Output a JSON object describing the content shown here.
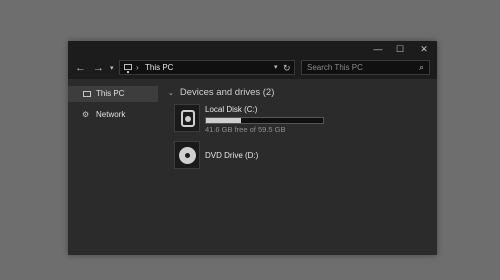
{
  "window": {
    "title": "This PC",
    "controls": {
      "minimize": "—",
      "maximize": "☐",
      "close": "✕"
    }
  },
  "nav": {
    "back_glyph": "←",
    "forward_glyph": "→",
    "recent_glyph": "▾",
    "breadcrumb_sep": "›",
    "breadcrumb": "This PC",
    "dropdown_glyph": "▾",
    "refresh_glyph": "↻",
    "search_placeholder": "Search This PC",
    "search_glyph": "⌕"
  },
  "sidebar": {
    "items": [
      {
        "label": "This PC",
        "icon": "monitor-icon",
        "selected": true
      },
      {
        "label": "Network",
        "icon": "network-icon",
        "selected": false
      }
    ],
    "network_glyph": "⚙"
  },
  "content": {
    "group_chevron": "⌄",
    "group_title": "Devices and drives (2)",
    "drives": [
      {
        "name": "Local Disk (C:)",
        "icon": "hard-drive-icon",
        "free_text": "41.6 GB free of 59.5 GB",
        "used_fraction": 0.3
      },
      {
        "name": "DVD Drive (D:)",
        "icon": "dvd-drive-icon"
      }
    ]
  },
  "colors": {
    "desktop": "#6e6e6e",
    "window_bg": "#2b2b2b",
    "chrome": "#1c1c1c",
    "selection": "#3d3d3d",
    "usage_bar": "#cfcfcf"
  }
}
